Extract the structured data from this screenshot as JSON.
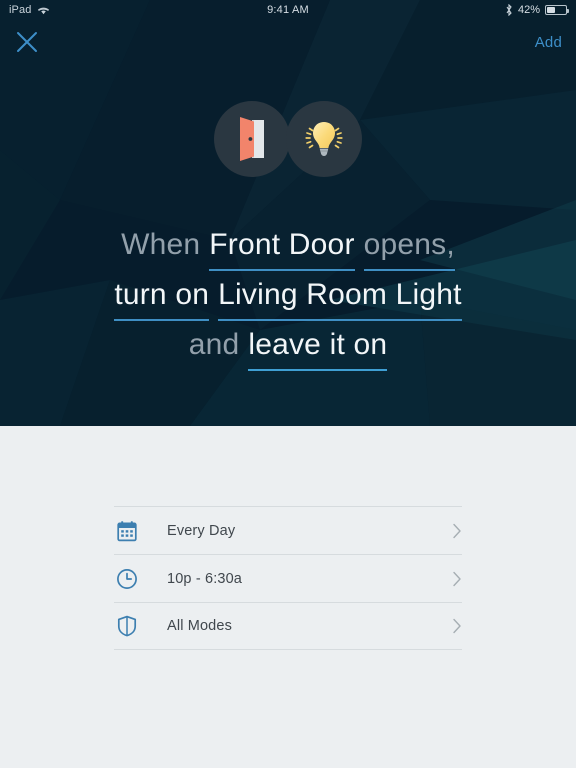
{
  "statusbar": {
    "device": "iPad",
    "wifi_icon": "wifi-icon",
    "time": "9:41 AM",
    "bluetooth_icon": "bluetooth-icon",
    "battery_percent": "42%",
    "battery_level": 42
  },
  "navbar": {
    "close_icon": "close-icon",
    "add_label": "Add"
  },
  "hero": {
    "background_color": "#061c2c",
    "icons": [
      {
        "name": "door-icon",
        "circle_color": "#2a3741",
        "door_color": "#f2846b"
      },
      {
        "name": "lightbulb-icon",
        "circle_color": "#2a3741",
        "bulb_color": "#fbdc8b"
      }
    ],
    "recipe": {
      "lines": [
        [
          {
            "text": "When",
            "style": "dim",
            "underline": false
          },
          {
            "text": "Front Door",
            "style": "lit",
            "underline": true
          },
          {
            "text": "opens,",
            "style": "dim",
            "underline": true
          }
        ],
        [
          {
            "text": "turn on",
            "style": "lit",
            "underline": true
          },
          {
            "text": "Living Room Light",
            "style": "lit",
            "underline": true
          }
        ],
        [
          {
            "text": "and",
            "style": "dim",
            "underline": false
          },
          {
            "text": "leave it on",
            "style": "lit",
            "underline": true
          }
        ]
      ]
    }
  },
  "list": {
    "rows": [
      {
        "icon": "calendar-icon",
        "label": "Every Day",
        "chevron": "chevron-right-icon"
      },
      {
        "icon": "clock-icon",
        "label": "10p - 6:30a",
        "chevron": "chevron-right-icon"
      },
      {
        "icon": "shield-icon",
        "label": "All Modes",
        "chevron": "chevron-right-icon"
      }
    ]
  },
  "colors": {
    "accent_blue": "#3d8fc9",
    "underline_blue": "#3f8fc4",
    "hero_bg": "#061c2c",
    "list_bg": "#eceff1",
    "icon_blue": "#3d7fb0"
  }
}
